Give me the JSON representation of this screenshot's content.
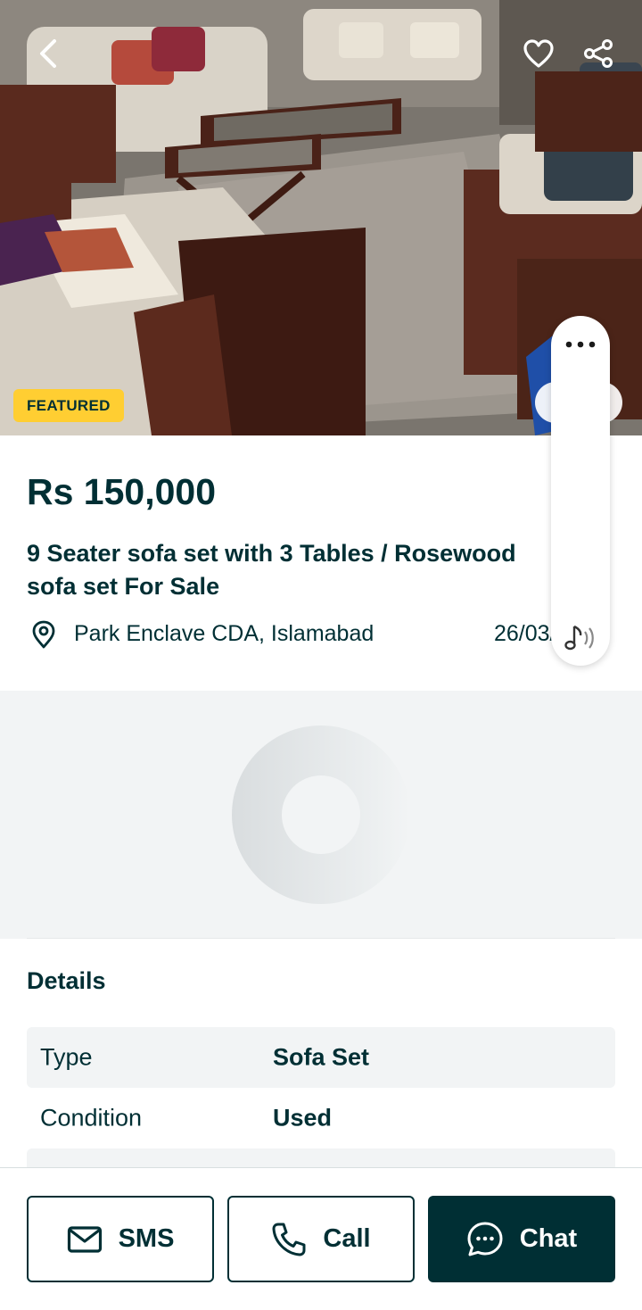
{
  "listing": {
    "badge": "FEATURED",
    "price": "Rs 150,000",
    "title": "9 Seater sofa set with 3 Tables / Rosewood sofa set For Sale",
    "location": "Park Enclave CDA, Islamabad",
    "date": "26/03/25"
  },
  "icons": {
    "back": "chevron-left-icon",
    "favorite": "heart-icon",
    "share": "share-icon",
    "more": "more-horizontal-icon",
    "audio": "music-note-icon",
    "location": "location-pin-icon",
    "sms": "mail-icon",
    "call": "phone-icon",
    "chat": "chat-bubble-icon"
  },
  "details": {
    "heading": "Details",
    "rows": [
      {
        "label": "Type",
        "value": "Sofa Set"
      },
      {
        "label": "Condition",
        "value": "Used"
      }
    ]
  },
  "actions": {
    "sms": "SMS",
    "call": "Call",
    "chat": "Chat"
  },
  "colors": {
    "brand_dark": "#002f34",
    "badge_yellow": "#ffce32",
    "surface_gray": "#f2f4f5"
  }
}
